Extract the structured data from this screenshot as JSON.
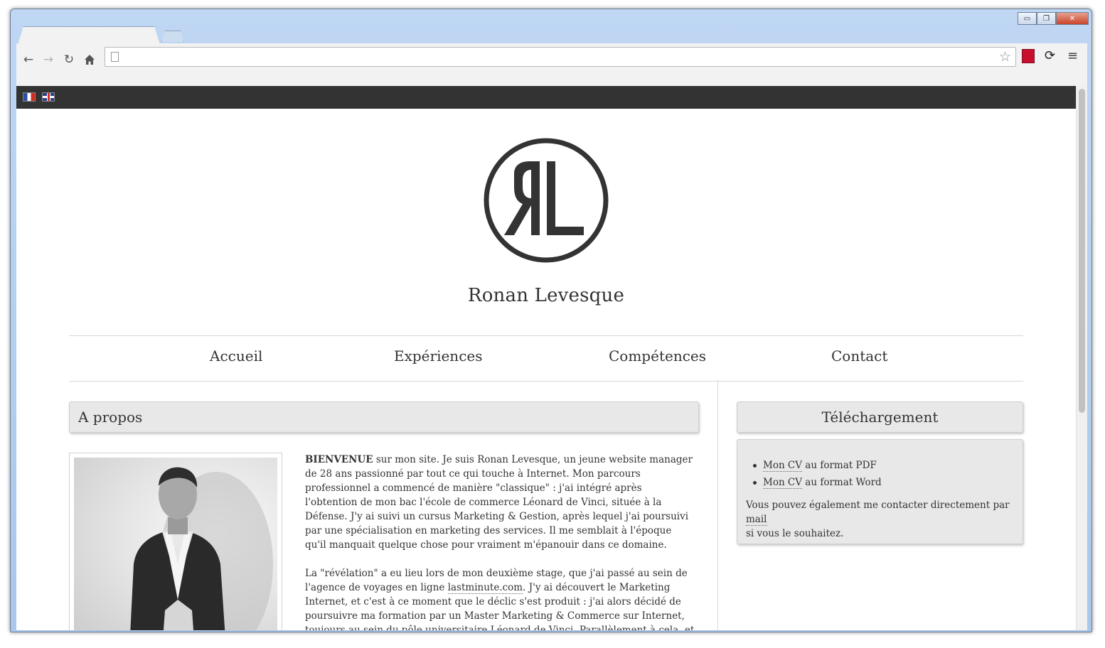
{
  "browser": {
    "url": "",
    "window_buttons": {
      "minimize": "▭",
      "maximize": "❐",
      "close": "✕"
    }
  },
  "lang": {
    "fr": "fr",
    "en": "en"
  },
  "site": {
    "logo_text": "ЯL",
    "name": "Ronan Levesque",
    "accent_color": "#333333"
  },
  "nav": {
    "items": [
      {
        "label": "Accueil"
      },
      {
        "label": "Expériences"
      },
      {
        "label": "Compétences"
      },
      {
        "label": "Contact"
      }
    ]
  },
  "about": {
    "title": "A propos",
    "p1_strong": "BIENVENUE",
    "p1_rest": " sur mon site. Je suis Ronan Levesque, un jeune website manager de 28 ans passionné par tout ce qui touche à Internet. Mon parcours professionnel a commencé de manière \"classique\" : j'ai intégré après l'obtention de mon bac l'école de commerce Léonard de Vinci, située à la Défense. J'y ai suivi un cursus Marketing & Gestion, après lequel j'ai poursuivi par une spécialisation en marketing des services. Il me semblait à l'époque qu'il manquait quelque chose pour vraiment m'épanouir dans ce domaine.",
    "p2_before": "La \"révélation\" a eu lieu lors de mon deuxième stage, que j'ai passé au sein de l'agence de voyages en ligne ",
    "p2_link": "lastminute.com",
    "p2_after": ". J'y ai découvert le Marketing Internet, et c'est à ce moment que le déclic s'est produit : j'ai alors décidé de poursuivre ma formation par un Master Marketing & Commerce sur Internet, toujours au sein du pôle universitaire Léonard de Vinci. Parallèlement à cela, et poussé par la curiosité ainsi que l'envie d'apprendre, j'ai commencé à créer des petits sites Internet afin de mieux saisir l'envers"
  },
  "download": {
    "title": "Téléchargement",
    "items": [
      {
        "link": "Mon CV",
        "rest": " au format PDF"
      },
      {
        "link": "Mon CV",
        "rest": " au format Word"
      }
    ],
    "contact_before": "Vous pouvez également me contacter directement par ",
    "contact_link": "mail",
    "contact_after": " si vous le souhaitez."
  }
}
